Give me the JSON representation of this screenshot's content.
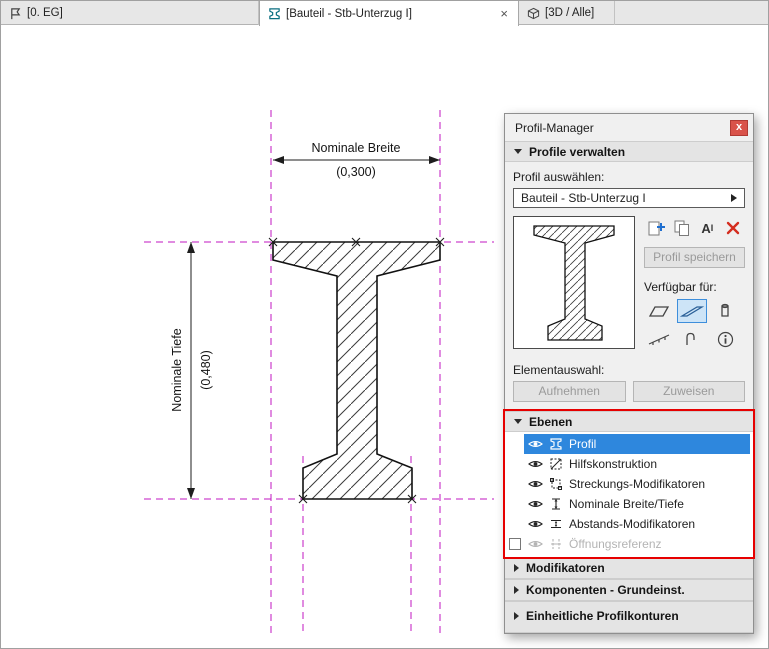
{
  "window": {
    "tabs": [
      {
        "label": "[0. EG]"
      },
      {
        "label": "[Bauteil - Stb-Unterzug I]",
        "close_glyph": "×"
      },
      {
        "label": "[3D / Alle]"
      }
    ]
  },
  "canvas": {
    "dim_width_label": "Nominale Breite",
    "dim_width_value": "(0,300)",
    "dim_depth_label": "Nominale Tiefe",
    "dim_depth_value": "(0,480)"
  },
  "panel": {
    "title": "Profil-Manager",
    "close_glyph": "x",
    "manage_section": "Profile verwalten",
    "select_label": "Profil auswählen:",
    "profile_name": "Bauteil - Stb-Unterzug I",
    "rename_icon_text": "A",
    "rename_icon_sup": "I",
    "save_button": "Profil speichern",
    "available_for_label": "Verfügbar für:",
    "element_selection_label": "Elementauswahl:",
    "pick_up_button": "Aufnehmen",
    "assign_button": "Zuweisen",
    "layers_section": "Ebenen",
    "layers": [
      {
        "label": "Profil",
        "state": "selected"
      },
      {
        "label": "Hilfskonstruktion",
        "state": "normal"
      },
      {
        "label": "Streckungs-Modifikatoren",
        "state": "normal"
      },
      {
        "label": "Nominale Breite/Tiefe",
        "state": "normal"
      },
      {
        "label": "Abstands-Modifikatoren",
        "state": "normal"
      },
      {
        "label": "Öffnungsreferenz",
        "state": "disabled"
      }
    ],
    "collapsed_sections": [
      {
        "label": "Modifikatoren"
      },
      {
        "label": "Komponenten - Grundeinst."
      },
      {
        "label": "Einheitliche Profilkonturen"
      }
    ]
  },
  "colors": {
    "selection_blue": "#2e87dd",
    "guide_magenta": "#c217c2",
    "annotation_red": "#e60000",
    "close_red": "#d9534a"
  }
}
